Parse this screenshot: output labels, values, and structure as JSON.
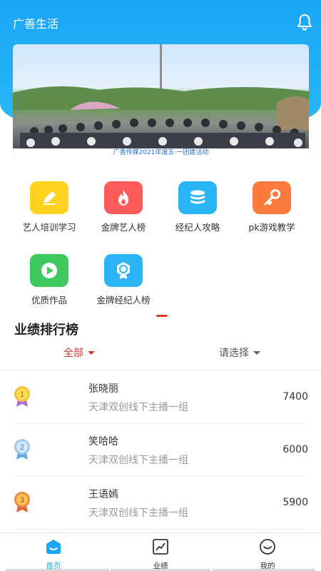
{
  "header": {
    "title": "广善生活",
    "bell_icon": "bell-icon"
  },
  "banner": {
    "caption": "广善传媒2021年度五·一团建活动",
    "image": "group-photo-banner"
  },
  "menu": [
    {
      "label": "艺人培训学习",
      "icon": "pencil-icon",
      "color": "#ffd21f"
    },
    {
      "label": "金牌艺人榜",
      "icon": "flame-icon",
      "color": "#ff5a5a"
    },
    {
      "label": "经纪人攻略",
      "icon": "database-icon",
      "color": "#2ab4f6"
    },
    {
      "label": "pk游戏教学",
      "icon": "key-icon",
      "color": "#ff7a3d"
    },
    {
      "label": "优质作品",
      "icon": "play-icon",
      "color": "#3dc95d"
    },
    {
      "label": "金牌经纪人榜",
      "icon": "badge-icon",
      "color": "#2ab4f6"
    }
  ],
  "ranking": {
    "title": "业绩排行榜",
    "filter_all": "全部",
    "filter_select": "请选择",
    "rows": [
      {
        "rank": "1",
        "name": "张晓丽",
        "group": "天津双创线下主播一组",
        "score": "7400",
        "medal_color": "#f3c33b"
      },
      {
        "rank": "2",
        "name": "笑哈哈",
        "group": "天津双创线下主播一组",
        "score": "6000",
        "medal_color": "#7fb8e8"
      },
      {
        "rank": "3",
        "name": "王语嫣",
        "group": "天津双创线下主播一组",
        "score": "5900",
        "medal_color": "#f08a3e"
      }
    ]
  },
  "tabbar": {
    "tabs": [
      {
        "label": "首页",
        "icon": "home-icon",
        "active": true
      },
      {
        "label": "业绩",
        "icon": "chart-icon",
        "active": false
      },
      {
        "label": "我的",
        "icon": "smile-icon",
        "active": false
      }
    ]
  },
  "colors": {
    "accent": "#1aa6f5",
    "filter_active": "#d23b2b"
  }
}
